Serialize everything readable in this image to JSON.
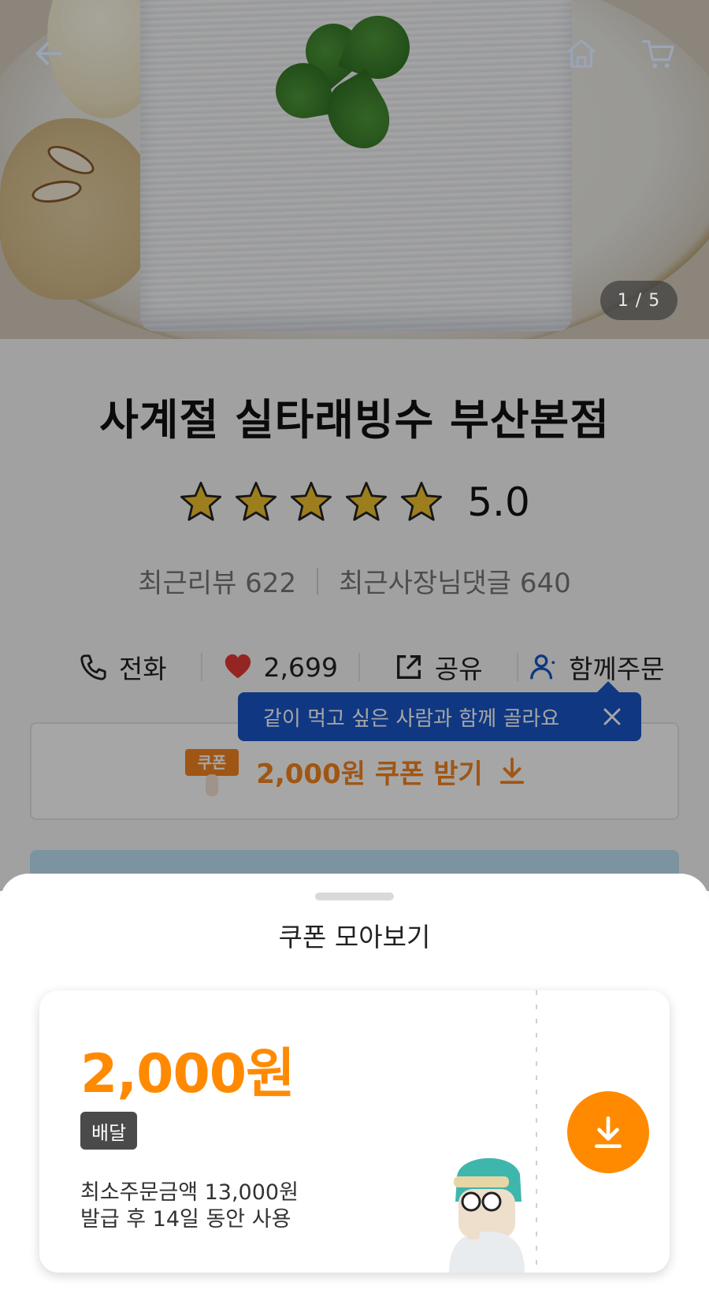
{
  "hero": {
    "image_counter": "1 / 5",
    "icons": [
      "back-arrow-icon",
      "home-icon",
      "cart-icon"
    ]
  },
  "store": {
    "name": "사계절 실타래빙수 부산본점",
    "rating": "5.0",
    "stars_filled": 5,
    "stars_total": 5,
    "recent_reviews": "최근리뷰 622",
    "owner_replies": "최근사장님댓글 640"
  },
  "actions": {
    "call": "전화",
    "likes": "2,699",
    "share": "공유",
    "group_order": "함께주문"
  },
  "tooltip": {
    "text": "같이 먹고 싶은 사람과 함께 골라요"
  },
  "coupon_bar": {
    "ticket_label": "쿠폰",
    "text": "2,000원 쿠폰 받기"
  },
  "sheet": {
    "title": "쿠폰 모아보기",
    "coupon": {
      "amount": "2,000원",
      "badge": "배달",
      "min_order": "최소주문금액 13,000원",
      "validity": "발급 후 14일 동안 사용"
    }
  },
  "colors": {
    "accent_orange": "#ff8a00",
    "tooltip_blue": "#1a55c7",
    "heart_red": "#e53935",
    "star_gold": "#f2c230"
  }
}
